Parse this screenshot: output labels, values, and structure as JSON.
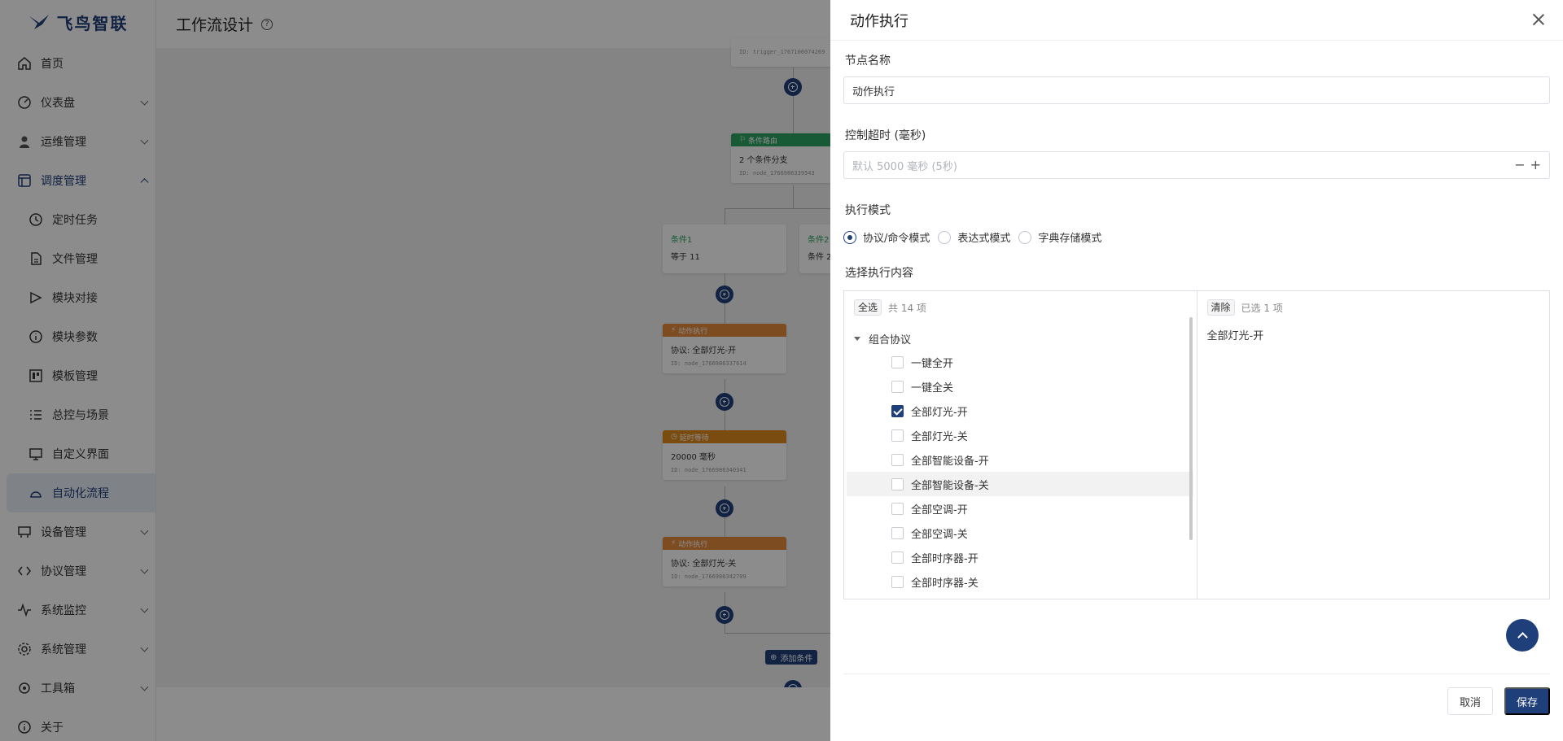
{
  "app": {
    "logo_text": "飞鸟智联"
  },
  "sidebar": {
    "items": [
      {
        "label": "首页",
        "icon": "home-icon"
      },
      {
        "label": "仪表盘",
        "icon": "dashboard-icon"
      },
      {
        "label": "运维管理",
        "icon": "user-icon"
      },
      {
        "label": "调度管理",
        "icon": "schedule-icon"
      },
      {
        "label": "定时任务",
        "icon": "clock-icon"
      },
      {
        "label": "文件管理",
        "icon": "file-icon"
      },
      {
        "label": "模块对接",
        "icon": "connect-icon"
      },
      {
        "label": "模块参数",
        "icon": "info-icon"
      },
      {
        "label": "模板管理",
        "icon": "template-icon"
      },
      {
        "label": "总控与场景",
        "icon": "list-icon"
      },
      {
        "label": "自定义界面",
        "icon": "screen-icon"
      },
      {
        "label": "自动化流程",
        "icon": "flow-icon"
      },
      {
        "label": "设备管理",
        "icon": "device-icon"
      },
      {
        "label": "协议管理",
        "icon": "code-icon"
      },
      {
        "label": "系统监控",
        "icon": "pulse-icon"
      },
      {
        "label": "系统管理",
        "icon": "gear-icon"
      },
      {
        "label": "工具箱",
        "icon": "toolbox-icon"
      },
      {
        "label": "关于",
        "icon": "about-icon"
      }
    ]
  },
  "main": {
    "title": "工作流设计"
  },
  "canvas": {
    "node_top_id": "ID: trigger_1767106074269",
    "branch_node": {
      "head": "条件路由",
      "title": "2 个条件分支",
      "id": "ID: node_1766986339543"
    },
    "cond1": {
      "label": "条件1",
      "text": "等于 11"
    },
    "cond2": {
      "label": "条件2",
      "text": "条件 2"
    },
    "action1": {
      "head": "动作执行",
      "title": "协议: 全部灯光-开",
      "id": "ID: node_1766986337614"
    },
    "wait": {
      "head": "延时等待",
      "title": "20000 毫秒",
      "id": "ID: node_1766986340341"
    },
    "action2": {
      "head": "动作执行",
      "title": "协议: 全部灯光-关",
      "id": "ID: node_1766986342709"
    },
    "add_condition": "添加条件"
  },
  "drawer": {
    "title": "动作执行",
    "node_name_label": "节点名称",
    "node_name_value": "动作执行",
    "timeout_label": "控制超时 (毫秒)",
    "timeout_placeholder": "默认 5000 毫秒 (5秒)",
    "mode_label": "执行模式",
    "modes": [
      "协议/命令模式",
      "表达式模式",
      "字典存储模式"
    ],
    "content_label": "选择执行内容",
    "left_panel": {
      "select_all": "全选",
      "count": "共 14 项",
      "group": "组合协议",
      "items": [
        {
          "label": "一键全开",
          "checked": false
        },
        {
          "label": "一键全关",
          "checked": false
        },
        {
          "label": "全部灯光-开",
          "checked": true
        },
        {
          "label": "全部灯光-关",
          "checked": false
        },
        {
          "label": "全部智能设备-开",
          "checked": false
        },
        {
          "label": "全部智能设备-关",
          "checked": false
        },
        {
          "label": "全部空调-开",
          "checked": false
        },
        {
          "label": "全部空调-关",
          "checked": false
        },
        {
          "label": "全部时序器-开",
          "checked": false
        },
        {
          "label": "全部时序器-关",
          "checked": false
        }
      ]
    },
    "right_panel": {
      "clear": "清除",
      "count": "已选 1 项",
      "selected": [
        "全部灯光-开"
      ]
    },
    "cancel": "取消",
    "save": "保存"
  }
}
